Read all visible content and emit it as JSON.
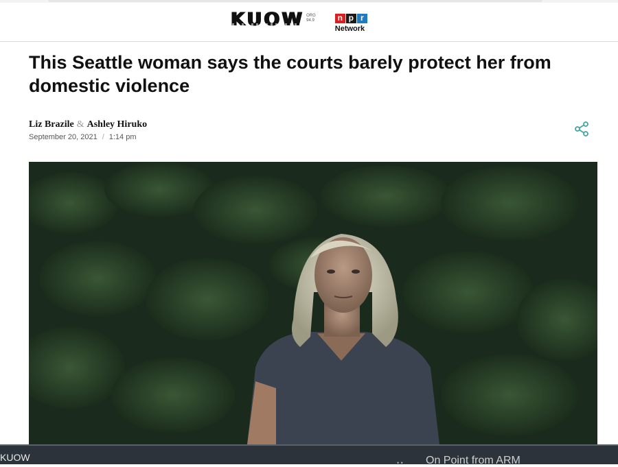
{
  "header": {
    "brand_name": "KUOW",
    "brand_freq_top": "ORG",
    "brand_freq_bottom": "94.9",
    "npr_letters": [
      "n",
      "p",
      "r"
    ],
    "npr_network": "Network"
  },
  "article": {
    "title": "This Seattle woman says the courts barely protect her from domestic violence",
    "authors": [
      "Liz Brazile",
      "Ashley Hiruko"
    ],
    "author_separator": "&",
    "date": "September 20, 2021",
    "date_separator": "/",
    "time": "1:14 pm",
    "share_icon": "share-icon"
  },
  "player": {
    "station": "KUOW",
    "now_playing": "On Point from ARM"
  },
  "colors": {
    "accent_share": "#3fa6a0",
    "npr_red": "#d62021",
    "npr_black": "#1a1a1a",
    "npr_blue": "#237bbd",
    "player_bg": "#2c333a"
  }
}
